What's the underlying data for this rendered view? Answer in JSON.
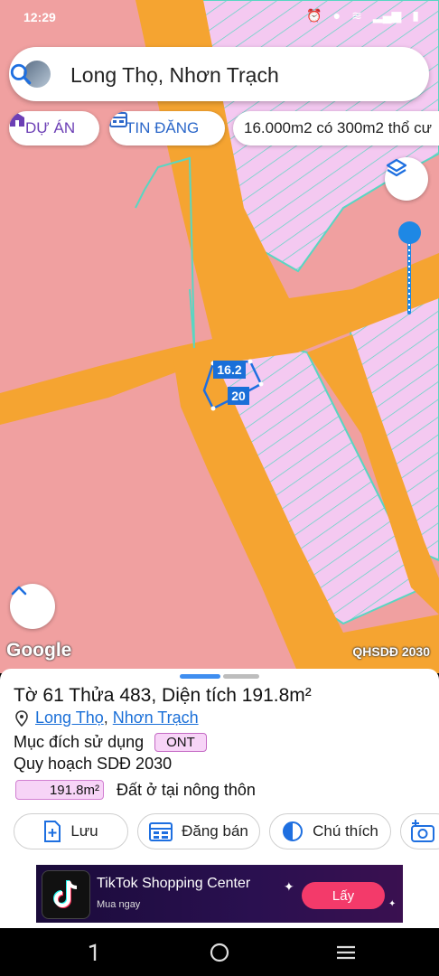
{
  "status_bar": {
    "time": "12:29"
  },
  "search": {
    "value": "Long Thọ, Nhơn Trạch"
  },
  "chips": [
    {
      "label": "DỰ ÁN"
    },
    {
      "label": "TIN ĐĂNG"
    },
    {
      "label": "16.000m2 có 300m2 thổ cư"
    }
  ],
  "map": {
    "parcel_label_width": "16.2",
    "parcel_label_length": "20",
    "google_label": "Google",
    "layer_name": "QHSDĐ 2030",
    "colors": {
      "residential": "#f4c9f1",
      "road": "#f5a431",
      "agri": "#f0a0a0",
      "parcel_line": "#59d6c2"
    }
  },
  "sheet": {
    "title": "Tờ 61 Thửa 483, Diện tích 191.8m²",
    "location_ward": "Long Thọ",
    "location_sep": ",",
    "location_district": "Nhơn Trạch",
    "purpose_label": "Mục đích sử dụng",
    "purpose_code": "ONT",
    "plan_label": "Quy hoạch SDĐ 2030",
    "plan_area": "191.8m²",
    "plan_desc": "Đất ở tại nông thôn",
    "buttons": {
      "save": "Lưu",
      "post": "Đăng bán",
      "legend": "Chú thích"
    }
  },
  "ad": {
    "title": "TikTok Shopping Center",
    "subtitle": "Mua ngay",
    "cta": "Lấy"
  }
}
